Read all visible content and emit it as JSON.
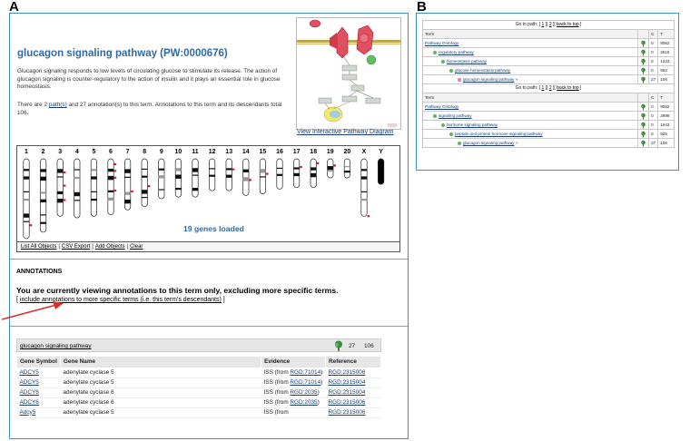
{
  "panel_labels": {
    "a": "A",
    "b": "B"
  },
  "panelA": {
    "title": "glucagon signaling pathway (PW:0000676)",
    "description": "Glucagon signaling responds to low levels of circulating glucose to stimulate its release. The action of glucagon signaling is counter-regulatory to the action of insulin and it plays an essential role in glucose homeostasis.",
    "count_pre": "There are 2 ",
    "count_link": "path(s)",
    "count_post": " and 27 annotation(s) to this term.    Annotations to this term and its descendants total 106.",
    "diagram_link": "View Interactive Pathway Diagram",
    "chromosomes": [
      "1",
      "2",
      "3",
      "4",
      "5",
      "6",
      "7",
      "8",
      "9",
      "10",
      "11",
      "12",
      "13",
      "14",
      "15",
      "16",
      "17",
      "18",
      "19",
      "20",
      "X",
      "Y"
    ],
    "genes_loaded": "19 genes loaded",
    "toolbar": {
      "list_all": "List All Objects",
      "csv": "CSV Export",
      "add": "Add Objects",
      "clear": "Clear"
    },
    "annotations_heading": "ANNOTATIONS",
    "annotations_msg": "You are currently viewing annotations to this term only, excluding more specific terms.",
    "include_pre": "[ ",
    "include_link": "include annotations to more specific terms (i.e. this term's descendants)",
    "include_post": " ]",
    "result_header": {
      "term": "glucagon signaling pathway",
      "c": "27",
      "t": "106"
    },
    "gene_table": {
      "headers": {
        "symbol": "Gene Symbol",
        "name": "Gene Name",
        "evidence": "Evidence",
        "reference": "Reference"
      },
      "rows": [
        {
          "symbol": "ADCY5",
          "name": "adenylate cyclase 5",
          "evidence_pre": "ISS (from ",
          "evidence_link": "RGD:71014",
          "evidence_post": ")",
          "reference": "RGD:2315006"
        },
        {
          "symbol": "ADCY5",
          "name": "adenylate cyclase 5",
          "evidence_pre": "ISS (from ",
          "evidence_link": "RGD:71014",
          "evidence_post": ")",
          "reference": "RGD:2315004"
        },
        {
          "symbol": "ADCY6",
          "name": "adenylate cyclase 6",
          "evidence_pre": "ISS (from ",
          "evidence_link": "RGD:2035",
          "evidence_post": ")",
          "reference": "RGD:2315004"
        },
        {
          "symbol": "ADCY6",
          "name": "adenylate cyclase 6",
          "evidence_pre": "ISS (from ",
          "evidence_link": "RGD:2035",
          "evidence_post": ")",
          "reference": "RGD:2315006"
        },
        {
          "symbol": "Adcy5",
          "name": "adenylate cyclase 5",
          "evidence_pre": "ISS (from",
          "evidence_link": "",
          "evidence_post": "",
          "reference": "RGD:2315006"
        }
      ]
    },
    "colors": {
      "title": "#2f6aa8",
      "frame": "#3f8fc9",
      "arrow": "#d9302a",
      "marker": "#cc1f3a"
    }
  },
  "panelB": {
    "goto_label": "Go to path: ",
    "goto_links": [
      "1",
      "2",
      "back to top"
    ],
    "col_term": "Term",
    "col_c": "C",
    "col_t": "T",
    "path1": [
      {
        "label": "Pathway Ontology",
        "c": "0",
        "t": "9062",
        "indent": 0,
        "icon": ""
      },
      {
        "label": "regulatory pathway",
        "c": "0",
        "t": "2516",
        "indent": 1,
        "icon": "green"
      },
      {
        "label": "homeostasis pathway",
        "c": "0",
        "t": "1233",
        "indent": 2,
        "icon": "green"
      },
      {
        "label": "glucose homeostasis pathway",
        "c": "0",
        "t": "952",
        "indent": 3,
        "icon": "green"
      },
      {
        "label": "glucagon signaling pathway",
        "suffix": " +",
        "c": "27",
        "t": "106",
        "indent": 4,
        "icon": "pink"
      }
    ],
    "path2": [
      {
        "label": "Pathway Ontology",
        "c": "0",
        "t": "9062",
        "indent": 0,
        "icon": ""
      },
      {
        "label": "signaling pathway",
        "c": "0",
        "t": "3998",
        "indent": 1,
        "icon": "green"
      },
      {
        "label": "hormone signaling pathway",
        "c": "0",
        "t": "1043",
        "indent": 2,
        "icon": "green"
      },
      {
        "label": "peptide and protein hormone signaling pathway",
        "c": "0",
        "t": "925",
        "indent": 3,
        "icon": "green"
      },
      {
        "label": "glucagon signaling pathway",
        "suffix": " +",
        "c": "27",
        "t": "106",
        "indent": 4,
        "icon": "green"
      }
    ]
  }
}
